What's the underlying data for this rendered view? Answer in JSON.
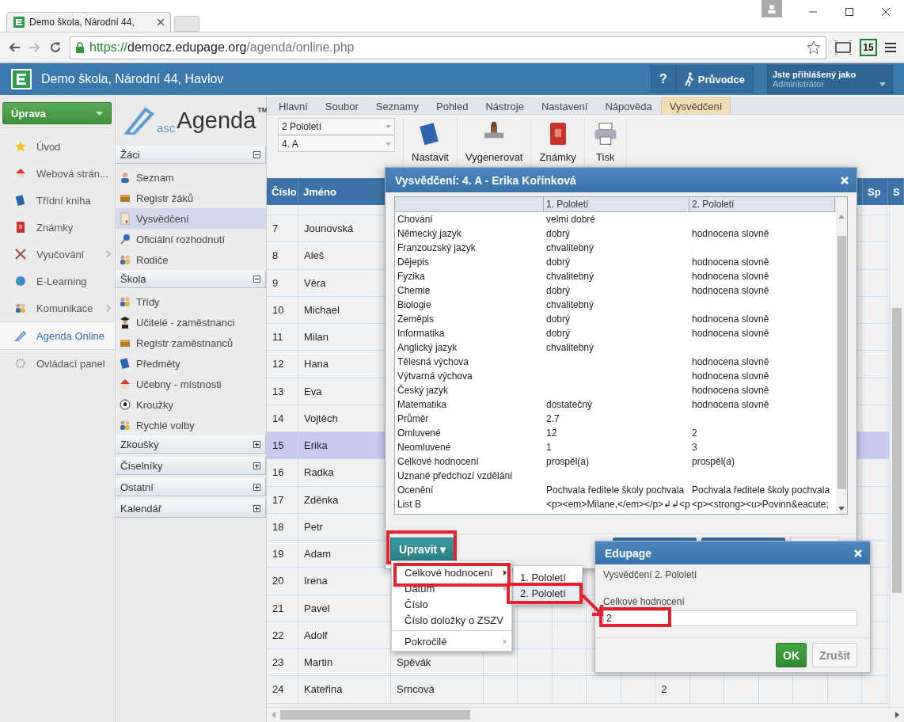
{
  "browser": {
    "tab_title": "Demo škola, Národní 44,",
    "url": {
      "scheme": "https://",
      "host": "democz.edupage.org",
      "path": "/agenda/online.php"
    },
    "extension_badge": "15"
  },
  "app_header": {
    "title": "Demo škola, Národní 44, Havlov",
    "help": "?",
    "guide": "Průvodce",
    "user_label": "Jste přihlášený jako",
    "user_name": "Administrátor"
  },
  "left_nav": {
    "action": "Úprava",
    "items": [
      {
        "label": "Úvod",
        "submenu": false,
        "selected": false
      },
      {
        "label": "Webová strán...",
        "submenu": false,
        "selected": false
      },
      {
        "label": "Třídní kniha",
        "submenu": false,
        "selected": false
      },
      {
        "label": "Známky",
        "submenu": false,
        "selected": false
      },
      {
        "label": "Vyučování",
        "submenu": true,
        "selected": false
      },
      {
        "label": "E-Learning",
        "submenu": false,
        "selected": false
      },
      {
        "label": "Komunikace",
        "submenu": true,
        "selected": false
      },
      {
        "label": "Agenda Online",
        "submenu": false,
        "selected": true
      },
      {
        "label": "Ovládací panel",
        "submenu": false,
        "selected": false
      }
    ]
  },
  "sidebar": {
    "logo": {
      "prefix": "asc",
      "name": "Agenda",
      "mark": "TM"
    },
    "sections": [
      {
        "title": "Žáci",
        "expanded": true,
        "items": [
          {
            "label": "Seznam",
            "selected": false
          },
          {
            "label": "Registr žáků",
            "selected": false
          },
          {
            "label": "Vysvědčení",
            "selected": true
          },
          {
            "label": "Oficiální rozhodnutí",
            "selected": false
          },
          {
            "label": "Rodiče",
            "selected": false
          }
        ]
      },
      {
        "title": "Škola",
        "expanded": true,
        "items": [
          {
            "label": "Třídy",
            "selected": false
          },
          {
            "label": "Učitelé - zaměstnanci",
            "selected": false
          },
          {
            "label": "Registr zaměstnanců",
            "selected": false
          },
          {
            "label": "Předměty",
            "selected": false
          },
          {
            "label": "Učebny - místnosti",
            "selected": false
          },
          {
            "label": "Kroužky",
            "selected": false
          },
          {
            "label": "Rychlé volby",
            "selected": false
          }
        ]
      },
      {
        "title": "Zkoušky",
        "expanded": false
      },
      {
        "title": "Číselníky",
        "expanded": false
      },
      {
        "title": "Ostatní",
        "expanded": false
      },
      {
        "title": "Kalendář",
        "expanded": false
      }
    ]
  },
  "ribbon": {
    "tabs": [
      {
        "label": "Hlavní",
        "selected": false
      },
      {
        "label": "Soubor",
        "selected": false
      },
      {
        "label": "Seznamy",
        "selected": false
      },
      {
        "label": "Pohled",
        "selected": false
      },
      {
        "label": "Nástroje",
        "selected": false
      },
      {
        "label": "Nastavení",
        "selected": false
      },
      {
        "label": "Nápověda",
        "selected": false
      },
      {
        "label": "Vysvědčení",
        "selected": true
      }
    ],
    "selects": [
      "2 Pololetí",
      "4. A"
    ],
    "tools": [
      "Nastavit",
      "Vygenerovat",
      "Známky",
      "Tisk"
    ]
  },
  "table": {
    "columns": [
      "Číslo",
      "Jméno"
    ],
    "end_columns": [
      "Sp",
      "S"
    ],
    "rows": [
      {
        "number": "7",
        "first_name": "Jounovská",
        "selected": false
      },
      {
        "number": "8",
        "first_name": "Aleš",
        "selected": false
      },
      {
        "number": "9",
        "first_name": "Věra",
        "selected": false
      },
      {
        "number": "10",
        "first_name": "Michael",
        "selected": false
      },
      {
        "number": "11",
        "first_name": "Milan",
        "selected": false
      },
      {
        "number": "12",
        "first_name": "Hana",
        "selected": false
      },
      {
        "number": "13",
        "first_name": "Eva",
        "selected": false
      },
      {
        "number": "14",
        "first_name": "Vojtěch",
        "selected": false
      },
      {
        "number": "15",
        "first_name": "Erika",
        "selected": true
      },
      {
        "number": "16",
        "first_name": "Radka",
        "selected": false
      },
      {
        "number": "17",
        "first_name": "Zděnka",
        "selected": false
      },
      {
        "number": "18",
        "first_name": "Petr",
        "selected": false
      },
      {
        "number": "19",
        "first_name": "Adam",
        "selected": false
      },
      {
        "number": "20",
        "first_name": "Irena",
        "selected": false
      },
      {
        "number": "21",
        "first_name": "Pavel",
        "selected": false
      },
      {
        "number": "22",
        "first_name": "Adolf",
        "selected": false
      },
      {
        "number": "23",
        "first_name": "Martin",
        "last_name": "Spěvák",
        "selected": false
      },
      {
        "number": "24",
        "first_name": "Kateřina",
        "last_name": "Srncová",
        "column_6": "2",
        "selected": false
      }
    ]
  },
  "report_dialog": {
    "title": "Vysvědčení: 4. A - Erika Kořínková",
    "columns": [
      "1. Pololetí",
      "2. Pololetí"
    ],
    "rows": [
      {
        "subject": "Chování",
        "first": "velmi dobré"
      },
      {
        "subject": "Německý jazyk",
        "first": "dobrý",
        "second": "hodnocena slovně"
      },
      {
        "subject": "Franzouzský jazyk",
        "first": "chvalitebný"
      },
      {
        "subject": "Dějepis",
        "first": "dobrý",
        "second": "hodnocena slovně"
      },
      {
        "subject": "Fyzika",
        "first": "chvalitebný",
        "second": "hodnocena slovně"
      },
      {
        "subject": "Chemie",
        "first": "dobrý",
        "second": "hodnocena slovně"
      },
      {
        "subject": "Biologie",
        "first": "chvalitebný"
      },
      {
        "subject": "Zeměpis",
        "first": "dobrý",
        "second": "hodnocena slovně"
      },
      {
        "subject": "Informatika",
        "first": "dobrý",
        "second": "hodnocena slovně"
      },
      {
        "subject": "Anglický jazyk",
        "first": "chvalitebný"
      },
      {
        "subject": "Tělesná výchova",
        "second": "hodnocena slovně"
      },
      {
        "subject": "Výtvarná výchova",
        "second": "hodnocena slovně"
      },
      {
        "subject": "Český jazyk",
        "second": "hodnocena slovně"
      },
      {
        "subject": "Matematika",
        "first": "dostatečný",
        "second": "hodnocena slovně"
      },
      {
        "subject": "Průměr",
        "first": "2.7"
      },
      {
        "subject": "Omluvené",
        "first": "12",
        "second": "2"
      },
      {
        "subject": "Neomluvené",
        "first": "1",
        "second": "3"
      },
      {
        "subject": "Celkové hodnocení",
        "first": "prospěl(a)",
        "second": "prospěl(a)"
      },
      {
        "subject": "Uznané předchozí vzdělání"
      },
      {
        "subject": "Ocenění",
        "first": "Pochvala ředitele školy pochvala",
        "second": "Pochvala ředitele školy pochvala"
      },
      {
        "subject": "List B",
        "first": "<p><em>Milane,</em></p>↲↲<p",
        "second": "<p><strong><u>Povinn&eacute;"
      }
    ],
    "edit_button": {
      "label": "Upravit ▾",
      "highlighted": true
    }
  },
  "edit_menu": {
    "items": [
      {
        "label": "Celkové hodnocení",
        "submenu": true,
        "highlighted": true,
        "separator_before": false
      },
      {
        "label": "Datum",
        "submenu": true,
        "highlighted": false,
        "separator_before": false
      },
      {
        "label": "Číslo",
        "submenu": false,
        "highlighted": false,
        "separator_before": false
      },
      {
        "label": "Číslo doložky o ZSZV",
        "submenu": false,
        "highlighted": false,
        "separator_before": false
      },
      {
        "label": "Pokročilé",
        "submenu": true,
        "highlighted": false,
        "separator_before": true
      }
    ],
    "submenu": [
      {
        "label": "1. Pololetí",
        "selected": false,
        "highlighted": false
      },
      {
        "label": "2. Pololetí",
        "selected": true,
        "highlighted": true
      }
    ]
  },
  "confirm_dialog": {
    "title": "Edupage",
    "message": "Vysvědčení 2. Pololetí",
    "field_label": "Celkové hodnocení",
    "field_value": "2",
    "field_highlighted": true,
    "arrow": true,
    "buttons": [
      "OK",
      "Zrušit"
    ]
  }
}
